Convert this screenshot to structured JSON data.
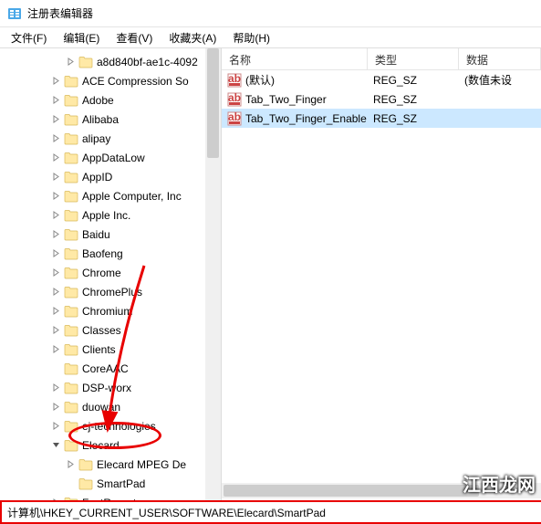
{
  "window": {
    "title": "注册表编辑器"
  },
  "menu": {
    "file": "文件(F)",
    "edit": "编辑(E)",
    "view": "查看(V)",
    "favorites": "收藏夹(A)",
    "help": "帮助(H)"
  },
  "tree": [
    {
      "indent": 70,
      "exp": "right",
      "label": "a8d840bf-ae1c-4092"
    },
    {
      "indent": 54,
      "exp": "right",
      "label": "ACE Compression So"
    },
    {
      "indent": 54,
      "exp": "right",
      "label": "Adobe"
    },
    {
      "indent": 54,
      "exp": "right",
      "label": "Alibaba"
    },
    {
      "indent": 54,
      "exp": "right",
      "label": "alipay"
    },
    {
      "indent": 54,
      "exp": "right",
      "label": "AppDataLow"
    },
    {
      "indent": 54,
      "exp": "right",
      "label": "AppID"
    },
    {
      "indent": 54,
      "exp": "right",
      "label": "Apple Computer, Inc"
    },
    {
      "indent": 54,
      "exp": "right",
      "label": "Apple Inc."
    },
    {
      "indent": 54,
      "exp": "right",
      "label": "Baidu"
    },
    {
      "indent": 54,
      "exp": "right",
      "label": "Baofeng"
    },
    {
      "indent": 54,
      "exp": "right",
      "label": "Chrome"
    },
    {
      "indent": 54,
      "exp": "right",
      "label": "ChromePlus"
    },
    {
      "indent": 54,
      "exp": "right",
      "label": "Chromium"
    },
    {
      "indent": 54,
      "exp": "right",
      "label": "Classes"
    },
    {
      "indent": 54,
      "exp": "right",
      "label": "Clients"
    },
    {
      "indent": 54,
      "exp": "none",
      "label": "CoreAAC"
    },
    {
      "indent": 54,
      "exp": "right",
      "label": "DSP-worx"
    },
    {
      "indent": 54,
      "exp": "right",
      "label": "duowan"
    },
    {
      "indent": 54,
      "exp": "right",
      "label": "ej-technologies"
    },
    {
      "indent": 54,
      "exp": "down",
      "label": "Elecard"
    },
    {
      "indent": 70,
      "exp": "right",
      "label": "Elecard MPEG De"
    },
    {
      "indent": 70,
      "exp": "none",
      "label": "SmartPad",
      "selected": false
    },
    {
      "indent": 54,
      "exp": "right",
      "label": "FastReport"
    }
  ],
  "list": {
    "columns": {
      "name": "名称",
      "type": "类型",
      "data": "数据"
    },
    "rows": [
      {
        "name": "(默认)",
        "type": "REG_SZ",
        "data": "(数值未设",
        "selected": false
      },
      {
        "name": "Tab_Two_Finger",
        "type": "REG_SZ",
        "data": "",
        "selected": false
      },
      {
        "name": "Tab_Two_Finger_Enable",
        "type": "REG_SZ",
        "data": "",
        "selected": true
      }
    ]
  },
  "status": {
    "path": "计算机\\HKEY_CURRENT_USER\\SOFTWARE\\Elecard\\SmartPad"
  },
  "watermark": "江西龙网"
}
